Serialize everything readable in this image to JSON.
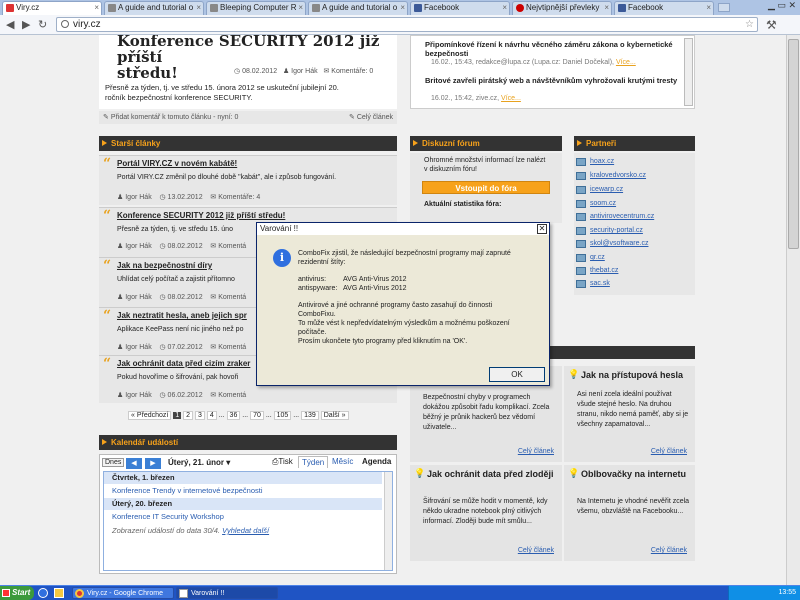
{
  "browser": {
    "tabs": [
      {
        "label": "Viry.cz",
        "color": "#d33"
      },
      {
        "label": "A guide and tutorial o",
        "color": "#888"
      },
      {
        "label": "Bleeping Computer R",
        "color": "#888"
      },
      {
        "label": "A guide and tutorial o",
        "color": "#888"
      },
      {
        "label": "Facebook",
        "color": "#3b5998"
      },
      {
        "label": "Nejvtipnější převleky",
        "color": "#c00"
      },
      {
        "label": "Facebook",
        "color": "#3b5998"
      }
    ],
    "url": "viry.cz"
  },
  "top_article": {
    "title_line1": "Konference SECURITY 2012 již příští",
    "title_line2": "středu!",
    "date": "08.02.2012",
    "author": "Igor Hák",
    "comments": "Komentáře: 0",
    "body_line1": "Přesně za týden, tj. ve středu 15. února 2012 se uskuteční jubilejní 20.",
    "body_line2": "ročník bezpečnostní konference SECURITY.",
    "add_comment": "Přidat komentář k tomuto článku - nyní: 0",
    "full_article": "Celý článek"
  },
  "news_ticker": [
    {
      "title": "Připomínkové řízení k návrhu věcného záměru zákona o kybernetické bezpečnosti",
      "meta": "16.02., 15:43, redakce@lupa.cz (Lupa.cz: Daniel Dočekal)",
      "more": "Více..."
    },
    {
      "title": "Britové zavřeli pirátský web a návštěvníkům vyhrožovali krutými tresty",
      "meta": "16.02., 15:42, zive.cz",
      "more": "Více..."
    }
  ],
  "older_articles": {
    "header": "Starší články",
    "items": [
      {
        "title": "Portál VIRY.CZ v novém kabátě!",
        "desc": "Portál VIRY.CZ změnil po dlouhé době \"kabát\", ale i způsob fungování.",
        "author": "Igor Hák",
        "date": "13.02.2012",
        "comments": "Komentáře: 4"
      },
      {
        "title": "Konference SECURITY 2012 již příští středu!",
        "desc": "Přesně za týden, tj. ve středu 15. úno",
        "author": "Igor Hák",
        "date": "08.02.2012",
        "comments": "Komentá"
      },
      {
        "title": "Jak na bezpečnostní díry",
        "desc": "Uhlídat celý počítač a zajistit přítomno",
        "author": "Igor Hák",
        "date": "08.02.2012",
        "comments": "Komentá"
      },
      {
        "title": "Jak neztratit hesla, aneb jejich spr",
        "desc": "Aplikace KeePass není nic jiného než po",
        "author": "Igor Hák",
        "date": "07.02.2012",
        "comments": "Komentá"
      },
      {
        "title": "Jak ochránit data před cizím zraker",
        "desc": "Pokud hovoříme o šifrování, pak hovoři",
        "author": "Igor Hák",
        "date": "06.02.2012",
        "comments": "Komentá"
      }
    ]
  },
  "pagination": {
    "prev": "« Předchozí",
    "pages": [
      "1",
      "2",
      "3",
      "4",
      "...",
      "36",
      "...",
      "70",
      "...",
      "105",
      "...",
      "139"
    ],
    "next": "Další »"
  },
  "forum": {
    "header": "Diskuzní fórum",
    "text": "Ohromné množství informací lze nalézt v diskuzním fóru!",
    "button": "Vstoupit do fóra",
    "stats": "Aktuální statistika fóra:"
  },
  "partners": {
    "header": "Partneři",
    "items": [
      "hoax.cz",
      "kralovedvorsko.cz",
      "icewarp.cz",
      "soom.cz",
      "antivirovecentrum.cz",
      "security-portal.cz",
      "skol@vsoftware.cz",
      "qr.cz",
      "thebat.cz",
      "sac.sk"
    ]
  },
  "calendar": {
    "header": "Kalendář událostí",
    "today": "Dnes",
    "date_label": "Úterý, 21. únor",
    "print": "Tisk",
    "views": [
      "Týden",
      "Měsíc",
      "Agenda"
    ],
    "days": [
      {
        "day": "Čtvrtek, 1. březen",
        "event": "Konference Trendy v internetové bezpečnosti"
      },
      {
        "day": "Úterý, 20. březen",
        "event": "Konference IT Security Workshop"
      }
    ],
    "footer": "Zobrazení událostí do data 30/4.",
    "footer_link": "Vyhledat další"
  },
  "tiles": [
    {
      "title": "",
      "body": "Bezpečnostní chyby v programech dokážou způsobit řadu komplikací. Zcela běžný je průnik hackerů bez vědomí uživatele...",
      "link": "Celý článek"
    },
    {
      "title": "Jak na přístupová hesla",
      "body": "Asi není zcela ideální používat všude stejné heslo. Na druhou stranu, nikdo nemá paměť, aby si je všechny zapamatoval...",
      "link": "Celý článek"
    },
    {
      "title": "Jak ochránit data před zloději",
      "body": "Šifrování se může hodit v momentě, kdy někdo ukradne notebook plný citlivých informací. Zloději bude mít smůlu...",
      "link": "Celý článek"
    },
    {
      "title": "Oblbovačky na internetu",
      "body": "Na Internetu je vhodné nevěřit zcela všemu, obzvláště na Facebooku...",
      "link": "Celý článek"
    }
  ],
  "dialog": {
    "title": "Varování !!",
    "intro1": "ComboFix zjistil, že následující bezpečnostní programy mají zapnuté",
    "intro2": "rezidentní štíty:",
    "row1_label": "antivirus:",
    "row1_value": "AVG Anti-Virus 2012",
    "row2_label": "antispyware:",
    "row2_value": "AVG Anti-Virus 2012",
    "warn1": "Antivirové a jiné ochranné programy často zasahují do činnosti",
    "warn2": "ComboFixu.",
    "warn3": "To může vést k nepředvídatelným výsledkům a možnému poškození",
    "warn4": "počítače.",
    "warn5": "Prosím ukončete tyto programy před kliknutím na 'OK'.",
    "ok": "OK"
  },
  "taskbar": {
    "start": "Start",
    "items": [
      "Viry.cz - Google Chrome",
      "Varování !!"
    ],
    "time": "13:55"
  }
}
